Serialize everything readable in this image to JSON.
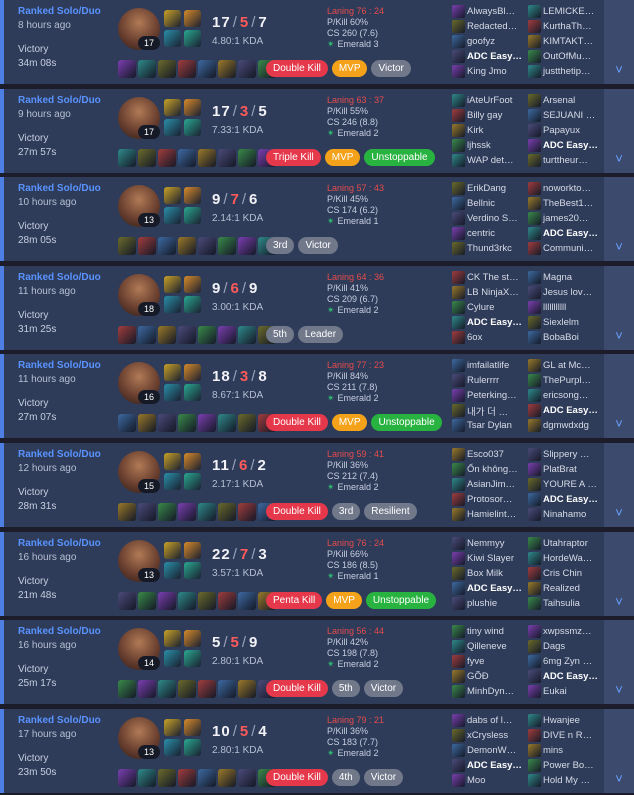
{
  "colors": {
    "accent": "#4e7fe3",
    "death": "#ff5a5a",
    "laning": "#e64b4b",
    "emerald": "#30c270"
  },
  "matches": [
    {
      "queue": "Ranked Solo/Duo",
      "time_ago": "8 hours ago",
      "result": "Victory",
      "duration": "34m 08s",
      "champ_level": "17",
      "kills": "17",
      "deaths": "5",
      "assists": "7",
      "kda_ratio": "4.80:1 KDA",
      "laning": "Laning 76 : 24",
      "pkill": "P/Kill 60%",
      "cs": "CS 260 (7.6)",
      "rank": "Emerald 3",
      "badges": [
        {
          "label": "Double Kill",
          "color": "red"
        },
        {
          "label": "MVP",
          "color": "orange"
        },
        {
          "label": "Victor",
          "color": "grey"
        }
      ],
      "players_left": [
        "AlwaysBl…",
        "Redacted…",
        "goofyz",
        "ADC Easy…",
        "King Jmo"
      ],
      "players_right": [
        "LEMICKE…",
        "KurthaTh…",
        "KIMTAKT…",
        "OutOfMu…",
        "justthetip…"
      ]
    },
    {
      "queue": "Ranked Solo/Duo",
      "time_ago": "9 hours ago",
      "result": "Victory",
      "duration": "27m 57s",
      "champ_level": "17",
      "kills": "17",
      "deaths": "3",
      "assists": "5",
      "kda_ratio": "7.33:1 KDA",
      "laning": "Laning 63 : 37",
      "pkill": "P/Kill 55%",
      "cs": "CS 246 (8.8)",
      "rank": "Emerald 2",
      "badges": [
        {
          "label": "Triple Kill",
          "color": "red"
        },
        {
          "label": "MVP",
          "color": "orange"
        },
        {
          "label": "Unstoppable",
          "color": "green"
        }
      ],
      "players_left": [
        "iAteUrFoot",
        "Billy gay",
        "Kirk",
        "ljhssk",
        "WAP det…"
      ],
      "players_right": [
        "Arsenal",
        "SEJUANI …",
        "Papayux",
        "ADC Easy…",
        "turttheur…"
      ]
    },
    {
      "queue": "Ranked Solo/Duo",
      "time_ago": "10 hours ago",
      "result": "Victory",
      "duration": "28m 05s",
      "champ_level": "13",
      "kills": "9",
      "deaths": "7",
      "assists": "6",
      "kda_ratio": "2.14:1 KDA",
      "laning": "Laning 57 : 43",
      "pkill": "P/Kill 45%",
      "cs": "CS 174 (6.2)",
      "rank": "Emerald 1",
      "badges": [
        {
          "label": "3rd",
          "color": "grey"
        },
        {
          "label": "Victor",
          "color": "grey"
        }
      ],
      "players_left": [
        "ErikDang",
        "Bellnic",
        "Verdino S…",
        "centric",
        "Thund3rkc"
      ],
      "players_right": [
        "noworkto…",
        "TheBest1…",
        "james20…",
        "ADC Easy…",
        "Communi…"
      ]
    },
    {
      "queue": "Ranked Solo/Duo",
      "time_ago": "11 hours ago",
      "result": "Victory",
      "duration": "31m 25s",
      "champ_level": "18",
      "kills": "9",
      "deaths": "6",
      "assists": "9",
      "kda_ratio": "3.00:1 KDA",
      "laning": "Laning 64 : 36",
      "pkill": "P/Kill 41%",
      "cs": "CS 209 (6.7)",
      "rank": "Emerald 2",
      "badges": [
        {
          "label": "5th",
          "color": "grey"
        },
        {
          "label": "Leader",
          "color": "grey"
        }
      ],
      "players_left": [
        "CK The st…",
        "LB NinjaX…",
        "Cylure",
        "ADC Easy…",
        "6ox"
      ],
      "players_right": [
        "Magna",
        "Jesus lov…",
        "lllllllllll",
        "Siexlelm",
        "BobaBoi"
      ]
    },
    {
      "queue": "Ranked Solo/Duo",
      "time_ago": "11 hours ago",
      "result": "Victory",
      "duration": "27m 07s",
      "champ_level": "16",
      "kills": "18",
      "deaths": "3",
      "assists": "8",
      "kda_ratio": "8.67:1 KDA",
      "laning": "Laning 77 : 23",
      "pkill": "P/Kill 84%",
      "cs": "CS 211 (7.8)",
      "rank": "Emerald 2",
      "badges": [
        {
          "label": "Double Kill",
          "color": "red"
        },
        {
          "label": "MVP",
          "color": "orange"
        },
        {
          "label": "Unstoppable",
          "color": "green"
        }
      ],
      "players_left": [
        "imfailatlife",
        "Rulerrrr",
        "Peterking…",
        "내가 더 …",
        "Tsar Dylan"
      ],
      "players_right": [
        "GL at Mc…",
        "ThePurpl…",
        "ericsong…",
        "ADC Easy…",
        "dgmwdxdg"
      ]
    },
    {
      "queue": "Ranked Solo/Duo",
      "time_ago": "12 hours ago",
      "result": "Victory",
      "duration": "28m 31s",
      "champ_level": "15",
      "kills": "11",
      "deaths": "6",
      "assists": "2",
      "kda_ratio": "2.17:1 KDA",
      "laning": "Laning 59 : 41",
      "pkill": "P/Kill 36%",
      "cs": "CS 212 (7.4)",
      "rank": "Emerald 2",
      "badges": [
        {
          "label": "Double Kill",
          "color": "red"
        },
        {
          "label": "3rd",
          "color": "grey"
        },
        {
          "label": "Resilient",
          "color": "grey"
        }
      ],
      "players_left": [
        "Esco037",
        "Ổn không…",
        "AsianJim…",
        "Protosor…",
        "Hamielint…"
      ],
      "players_right": [
        "Slippery …",
        "PlatBrat",
        "YOURE A …",
        "ADC Easy…",
        "Ninahamo"
      ]
    },
    {
      "queue": "Ranked Solo/Duo",
      "time_ago": "16 hours ago",
      "result": "Victory",
      "duration": "21m 48s",
      "champ_level": "13",
      "kills": "22",
      "deaths": "7",
      "assists": "3",
      "kda_ratio": "3.57:1 KDA",
      "laning": "Laning 76 : 24",
      "pkill": "P/Kill 66%",
      "cs": "CS 186 (8.5)",
      "rank": "Emerald 1",
      "badges": [
        {
          "label": "Penta Kill",
          "color": "red"
        },
        {
          "label": "MVP",
          "color": "orange"
        },
        {
          "label": "Unstoppable",
          "color": "green"
        }
      ],
      "players_left": [
        "Nemmyy",
        "Kiwi Slayer",
        "Box Milk",
        "ADC Easy…",
        "plushie"
      ],
      "players_right": [
        "Utahraptor",
        "HordeWa…",
        "Cris Chin",
        "Realized",
        "Taihsulia"
      ]
    },
    {
      "queue": "Ranked Solo/Duo",
      "time_ago": "16 hours ago",
      "result": "Victory",
      "duration": "25m 17s",
      "champ_level": "14",
      "kills": "5",
      "deaths": "5",
      "assists": "9",
      "kda_ratio": "2.80:1 KDA",
      "laning": "Laning 56 : 44",
      "pkill": "P/Kill 42%",
      "cs": "CS 198 (7.8)",
      "rank": "Emerald 2",
      "badges": [
        {
          "label": "Double Kill",
          "color": "red"
        },
        {
          "label": "5th",
          "color": "grey"
        },
        {
          "label": "Victor",
          "color": "grey"
        }
      ],
      "players_left": [
        "tiny wind",
        "Qilleneve",
        "fyve",
        "GÕÐ",
        "MinhDyn…"
      ],
      "players_right": [
        "xwpssmz…",
        "Dags",
        "6mg Zyn …",
        "ADC Easy…",
        "Eukai"
      ]
    },
    {
      "queue": "Ranked Solo/Duo",
      "time_ago": "17 hours ago",
      "result": "Victory",
      "duration": "23m 50s",
      "champ_level": "13",
      "kills": "10",
      "deaths": "5",
      "assists": "4",
      "kda_ratio": "2.80:1 KDA",
      "laning": "Laning 79 : 21",
      "pkill": "P/Kill 36%",
      "cs": "CS 183 (7.7)",
      "rank": "Emerald 2",
      "badges": [
        {
          "label": "Double Kill",
          "color": "red"
        },
        {
          "label": "4th",
          "color": "grey"
        },
        {
          "label": "Victor",
          "color": "grey"
        }
      ],
      "players_left": [
        "dabs of l…",
        "xCrysless",
        "DemonW…",
        "ADC Easy…",
        "Moo"
      ],
      "players_right": [
        "Hwanjee",
        "DIVE n R…",
        "mins",
        "Power Bo…",
        "Hold My …"
      ]
    }
  ]
}
